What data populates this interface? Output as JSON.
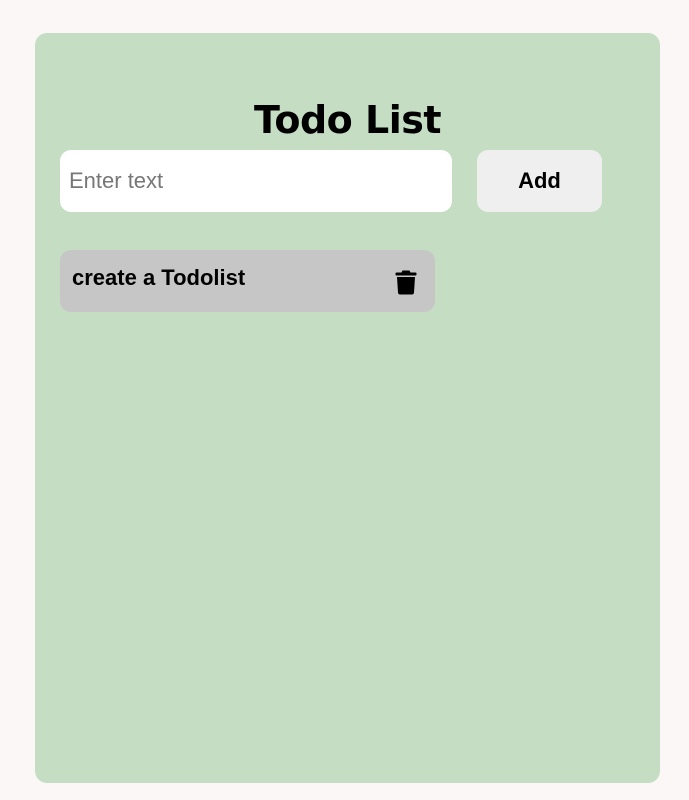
{
  "app": {
    "title": "Todo List"
  },
  "input": {
    "placeholder": "Enter text",
    "value": ""
  },
  "add_button": {
    "label": "Add"
  },
  "todos": [
    {
      "text": "create a Todolist",
      "delete_icon": "trash-icon"
    }
  ],
  "colors": {
    "page_background": "#faf7f6",
    "card_background": "#c4ddc3",
    "todo_item_background": "#c6c6c6",
    "add_button_background": "#efefef"
  }
}
